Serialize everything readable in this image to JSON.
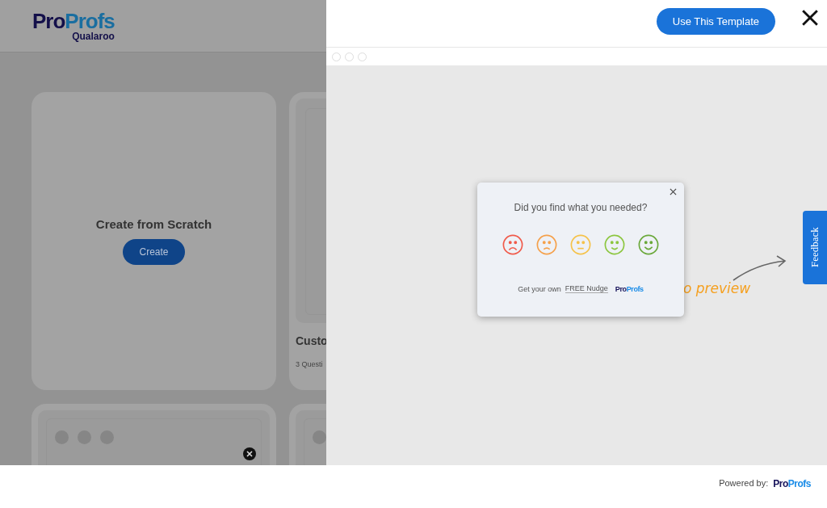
{
  "background_page": {
    "logo": {
      "parts": [
        "Pro",
        "Profs"
      ],
      "product": "Qualaroo"
    },
    "cards": [
      {
        "kind": "scratch",
        "title": "Create from Scratch",
        "button": "Create"
      },
      {
        "kind": "template",
        "title": "Custo",
        "meta": "3 Questi"
      }
    ],
    "lower_cards": [
      {
        "kind": "preview"
      },
      {
        "kind": "preview"
      }
    ]
  },
  "preview_panel": {
    "use_button": "Use This Template",
    "survey": {
      "question": "Did you find what you needed?",
      "ratings": [
        {
          "kind": "very-sad",
          "color": "#f05a4a"
        },
        {
          "kind": "sad",
          "color": "#f5a04a"
        },
        {
          "kind": "neutral",
          "color": "#f5c24a"
        },
        {
          "kind": "happy",
          "color": "#8cc63f"
        },
        {
          "kind": "very-happy",
          "color": "#6aa83a"
        }
      ],
      "footer_text": "Get your own",
      "footer_link": "FREE Nudge",
      "brand": [
        "Pro",
        "Profs"
      ]
    },
    "annotation": "o preview",
    "feedback_tab": "Feedback"
  },
  "footer": {
    "label": "Powered by:",
    "brand": [
      "Pro",
      "Profs"
    ]
  }
}
